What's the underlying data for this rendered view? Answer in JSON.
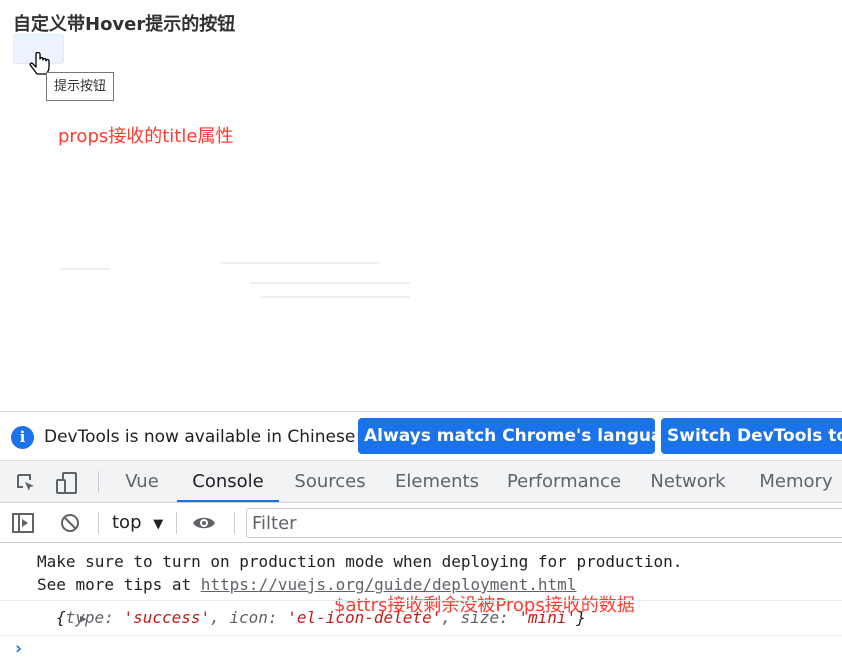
{
  "page": {
    "title": "自定义带Hover提示的按钮",
    "tooltip": "提示按钮",
    "annotation_title": "props接收的title属性"
  },
  "infobar": {
    "message": "DevTools is now available in Chinese!",
    "always_match_label": "Always match Chrome's language",
    "switch_label": "Switch DevTools to C"
  },
  "tabs": [
    {
      "label": "Vue"
    },
    {
      "label": "Console",
      "active": true
    },
    {
      "label": "Sources"
    },
    {
      "label": "Elements"
    },
    {
      "label": "Performance"
    },
    {
      "label": "Network"
    },
    {
      "label": "Memory"
    }
  ],
  "consolebar": {
    "context": "top",
    "filter_placeholder": "Filter",
    "annotation_attrs": "$attrs接收剩余没被Props接收的数据"
  },
  "console": {
    "line1": "Make sure to turn on production mode when deploying for production.",
    "line2_prefix": "See more tips at ",
    "line2_link": "https://vuejs.org/guide/deployment.html",
    "obj_open": "{",
    "k_type": "type: ",
    "v_type": "'success'",
    "k_icon": ", icon: ",
    "v_icon": "'el-icon-delete'",
    "k_size": ", size: ",
    "v_size": "'mini'",
    "obj_close": "}"
  },
  "colors": {
    "accent": "#1a73e8",
    "annotation": "#ff3b30"
  }
}
